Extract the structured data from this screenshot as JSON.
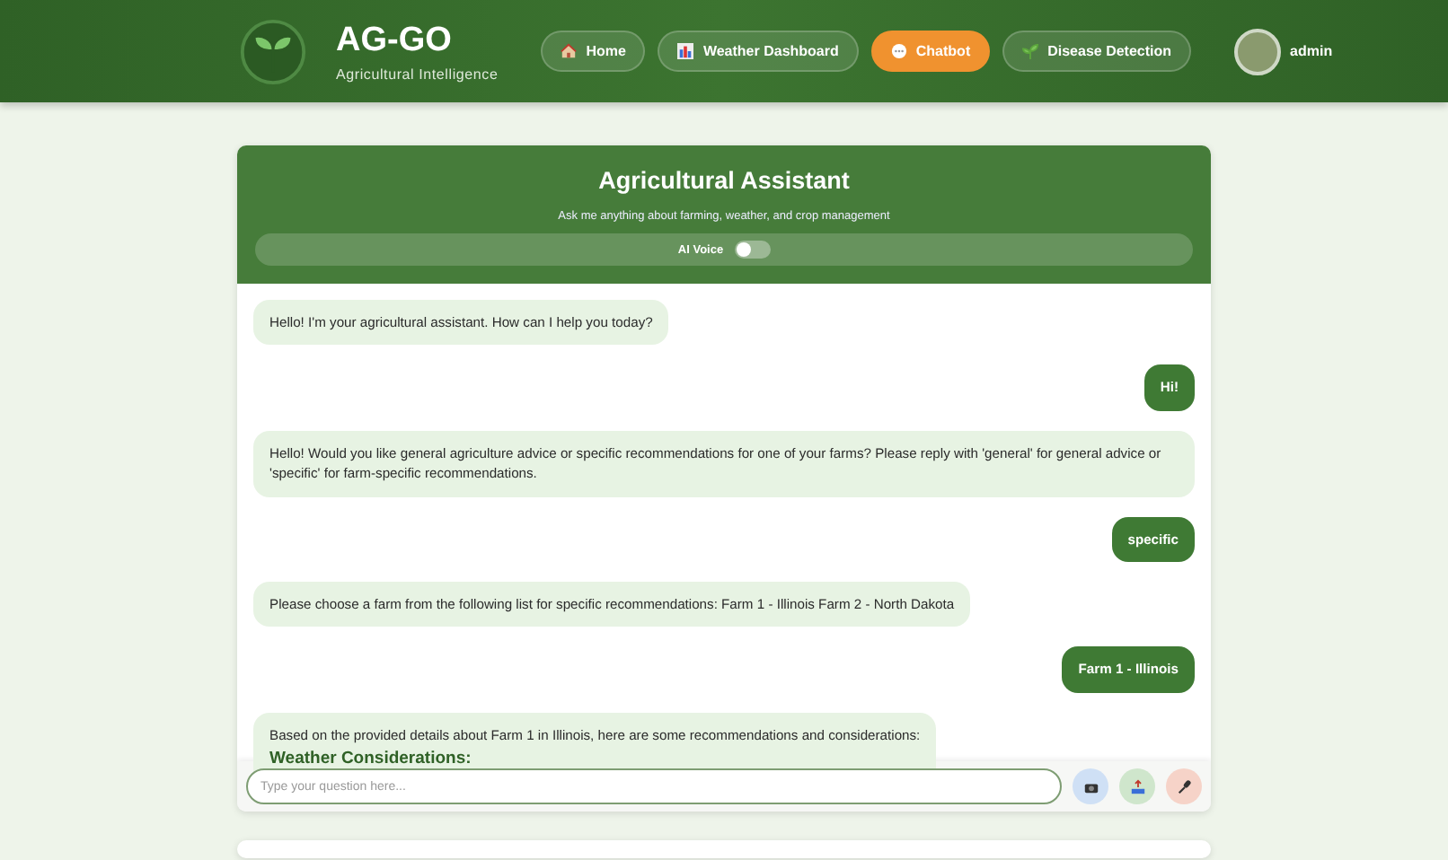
{
  "brand": {
    "title": "AG-GO",
    "subtitle": "Agricultural Intelligence"
  },
  "nav": [
    {
      "kind": "home",
      "label": "Home",
      "selected": false
    },
    {
      "kind": "weather",
      "label": "Weather Dashboard",
      "selected": false
    },
    {
      "kind": "chat",
      "label": "Chatbot",
      "selected": true
    },
    {
      "kind": "disease",
      "label": "Disease Detection",
      "selected": false
    }
  ],
  "user": {
    "name": "admin"
  },
  "chat": {
    "title": "Agricultural Assistant",
    "subtitle": "Ask me anything about farming, weather, and crop management",
    "voice": {
      "label": "AI Voice",
      "on": false
    },
    "messages": [
      {
        "kind": "bot",
        "text": "Hello! I'm your agricultural assistant. How can I help you today?"
      },
      {
        "kind": "user",
        "text": "Hi!"
      },
      {
        "kind": "bot",
        "text": "Hello! Would you like general agriculture advice or specific recommendations for one of your farms? Please reply with 'general' for general advice or 'specific' for farm-specific recommendations."
      },
      {
        "kind": "user",
        "text": "specific"
      },
      {
        "kind": "bot",
        "text": "Please choose a farm from the following list for specific recommendations: Farm 1 - Illinois Farm 2 - North Dakota"
      },
      {
        "kind": "user",
        "text": "Farm 1 - Illinois"
      },
      {
        "kind": "bot",
        "text": "Based on the provided details about Farm 1 in Illinois, here are some recommendations and considerations:",
        "heading": "Weather Considerations:"
      }
    ],
    "input": {
      "placeholder": "Type your question here..."
    },
    "actions": [
      {
        "kind": "camera"
      },
      {
        "kind": "upload"
      },
      {
        "kind": "mic"
      }
    ]
  }
}
